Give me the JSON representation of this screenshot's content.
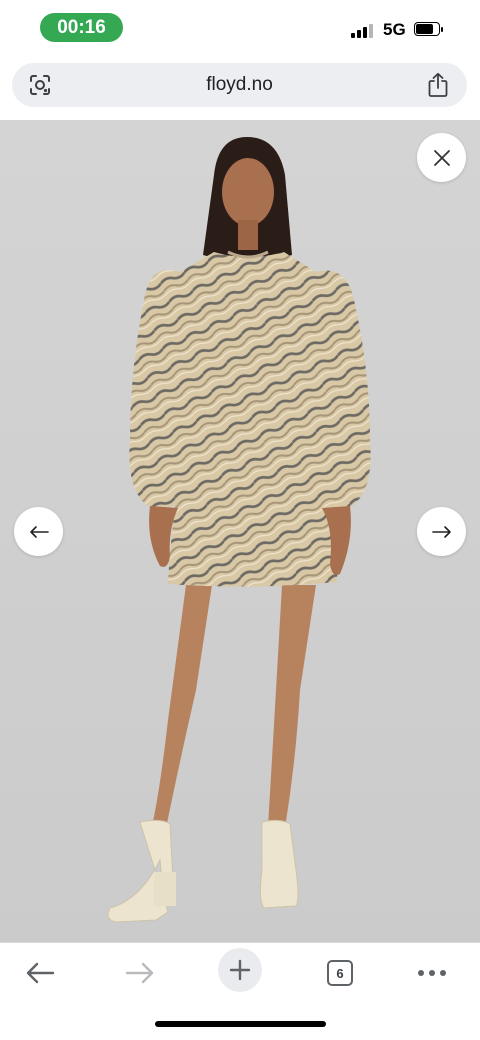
{
  "status_bar": {
    "time": "00:16",
    "network": "5G",
    "time_pill_color": "#34a853"
  },
  "browser": {
    "url": "floyd.no",
    "lens_icon": "google-lens-icon",
    "share_icon": "share-icon"
  },
  "gallery": {
    "image": "model-wearing-metallic-zebra-print-mini-dress",
    "background_color": "#d3d3d3",
    "close_icon": "close-icon",
    "prev_icon": "arrow-left-icon",
    "next_icon": "arrow-right-icon"
  },
  "toolbar": {
    "back_icon": "back-arrow-icon",
    "forward_icon": "forward-arrow-icon",
    "new_tab_icon": "plus-icon",
    "tab_count": "6",
    "menu_icon": "more-dots-icon"
  }
}
